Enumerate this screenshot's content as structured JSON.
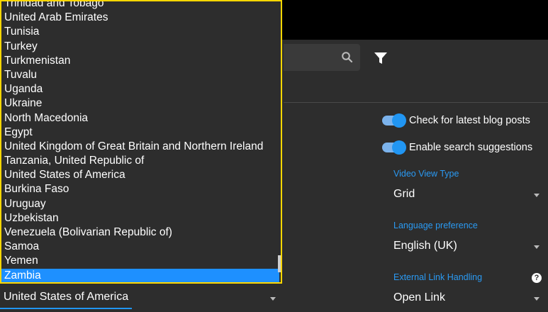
{
  "toolbar": {
    "search_icon": "search-icon",
    "filter_icon": "filter-icon"
  },
  "settings": {
    "blog_posts_toggle": {
      "label": "Check for latest blog posts",
      "on": true
    },
    "search_suggestions_toggle": {
      "label": "Enable search suggestions",
      "on": true
    },
    "video_view_type": {
      "label": "Video View Type",
      "value": "Grid"
    },
    "language_preference": {
      "label": "Language preference",
      "value": "English (UK)"
    },
    "external_link_handling": {
      "label": "External Link Handling",
      "value": "Open Link",
      "help": "?"
    }
  },
  "country_select": {
    "value": "United States of America",
    "options": [
      "Trinidad and Tobago",
      "United Arab Emirates",
      "Tunisia",
      "Turkey",
      "Turkmenistan",
      "Tuvalu",
      "Uganda",
      "Ukraine",
      "North Macedonia",
      "Egypt",
      "United Kingdom of Great Britain and Northern Ireland",
      "Tanzania, United Republic of",
      "United States of America",
      "Burkina Faso",
      "Uruguay",
      "Uzbekistan",
      "Venezuela (Bolivarian Republic of)",
      "Samoa",
      "Yemen",
      "Zambia"
    ],
    "highlighted": "Zambia"
  },
  "colors": {
    "accent": "#2196f3",
    "background": "#2d2d2d",
    "focus_outline": "#ffd700",
    "highlight": "#1e90ff"
  }
}
